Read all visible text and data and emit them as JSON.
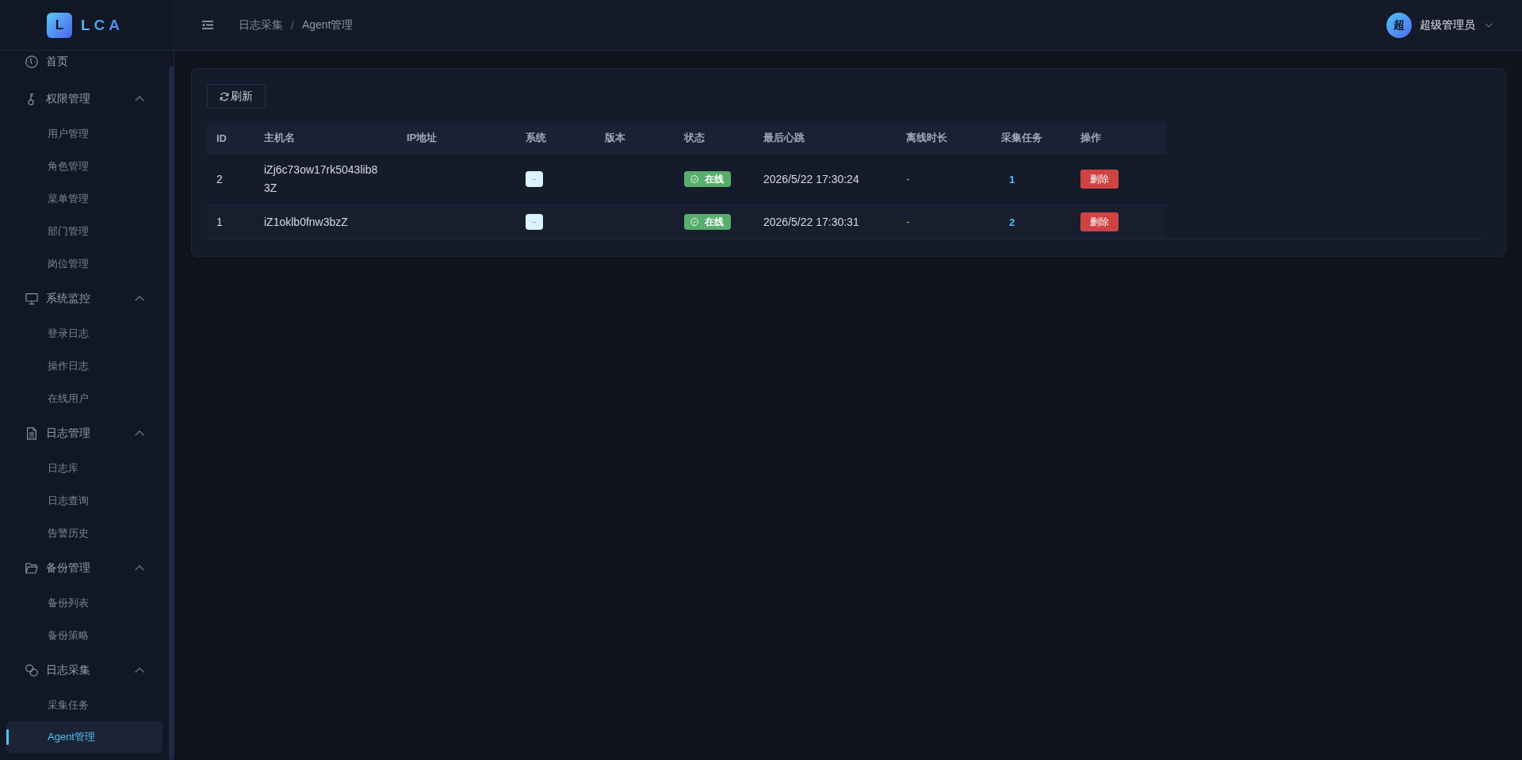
{
  "logo": {
    "letter": "L",
    "name": "LCA"
  },
  "sidebar": {
    "items": [
      {
        "kind": "link",
        "label": "首页",
        "selected": false
      },
      {
        "kind": "group",
        "label": "权限管理",
        "expanded": true,
        "children": [
          {
            "label": "用户管理",
            "selected": false
          },
          {
            "label": "角色管理",
            "selected": false
          },
          {
            "label": "菜单管理",
            "selected": false
          },
          {
            "label": "部门管理",
            "selected": false
          },
          {
            "label": "岗位管理",
            "selected": false
          }
        ]
      },
      {
        "kind": "group",
        "label": "系统监控",
        "expanded": true,
        "children": [
          {
            "label": "登录日志",
            "selected": false
          },
          {
            "label": "操作日志",
            "selected": false
          },
          {
            "label": "在线用户",
            "selected": false
          }
        ]
      },
      {
        "kind": "group",
        "label": "日志管理",
        "expanded": true,
        "children": [
          {
            "label": "日志库",
            "selected": false
          },
          {
            "label": "日志查询",
            "selected": false
          },
          {
            "label": "告警历史",
            "selected": false
          }
        ]
      },
      {
        "kind": "group",
        "label": "备份管理",
        "expanded": true,
        "children": [
          {
            "label": "备份列表",
            "selected": false
          },
          {
            "label": "备份策略",
            "selected": false
          }
        ]
      },
      {
        "kind": "group",
        "label": "日志采集",
        "expanded": true,
        "children": [
          {
            "label": "采集任务",
            "selected": false
          },
          {
            "label": "Agent管理",
            "selected": true
          }
        ]
      }
    ]
  },
  "header": {
    "breadcrumb": {
      "separator": "/",
      "items": [
        {
          "label": "日志采集"
        },
        {
          "label": "Agent管理"
        }
      ]
    },
    "user": {
      "avatar": "超",
      "name": "超级管理员"
    }
  },
  "toolbar": {
    "buttons": [
      {
        "label": "刷新"
      }
    ]
  },
  "table": {
    "columns": [
      "ID",
      "主机名",
      "IP地址",
      "系统",
      "版本",
      "状态",
      "最后心跳",
      "离线时长",
      "采集任务",
      "操作"
    ],
    "rows": [
      {
        "id": "2",
        "hostname": "iZj6c73ow17rk5043lib83Z",
        "system": "-",
        "status": "在线",
        "online": true,
        "last_heartbeat": "2026/5/22 17:30:24",
        "offline_duration": "-",
        "tasks": "1",
        "action": "删除"
      },
      {
        "id": "1",
        "hostname": "iZ1oklb0fnw3bzZ",
        "system": "-",
        "status": "在线",
        "online": true,
        "last_heartbeat": "2026/5/22 17:30:31",
        "offline_duration": "-",
        "tasks": "2",
        "action": "删除"
      }
    ]
  }
}
